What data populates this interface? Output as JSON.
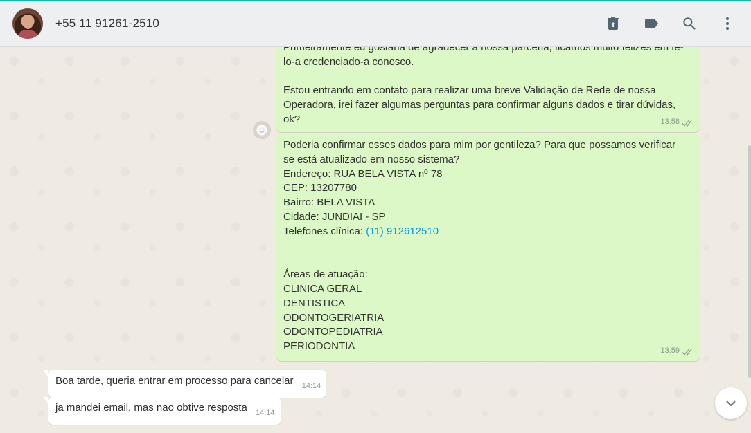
{
  "header": {
    "contact_name": "+55 11 91261-2510",
    "icons": [
      "delete-icon",
      "label-icon",
      "search-icon",
      "menu-icon"
    ]
  },
  "messages": {
    "m1": {
      "lines": [
        "Primeiramente eu gostaria de agradecer a nossa parceria, ficamos muito felizes em tê-",
        "lo-a credenciado-a conosco.",
        "",
        "Estou entrando em contato para realizar uma breve Validação de Rede de nossa",
        "Operadora, irei fazer algumas perguntas para confirmar alguns dados e tirar dúvidas,",
        "ok?"
      ],
      "time": "13:58"
    },
    "m2": {
      "lines": [
        "Poderia confirmar esses dados para mim por gentileza? Para que possamos verificar",
        "se está atualizado em nosso sistema?",
        "Endereço: RUA BELA VISTA nº 78",
        "CEP: 13207780",
        "Bairro: BELA VISTA",
        "Cidade: JUNDIAI - SP"
      ],
      "phone_label": "Telefones clínica: ",
      "phone_link": "(11) 912612510",
      "areas_title": "Áreas de atuação:",
      "areas": [
        "CLINICA GERAL",
        "DENTISTICA",
        "ODONTOGERIATRIA",
        "ODONTOPEDIATRIA",
        "PERIODONTIA"
      ],
      "time": "13:59"
    },
    "m3": {
      "text": "Boa tarde, queria entrar em processo para cancelar",
      "time": "14:14"
    },
    "m4": {
      "text": "ja mandei email, mas nao obtive resposta",
      "time": "14:14"
    }
  },
  "colors": {
    "outgoing": "#dcf8c6",
    "incoming": "#ffffff",
    "link": "#039be5",
    "accent": "#00bfa5"
  }
}
